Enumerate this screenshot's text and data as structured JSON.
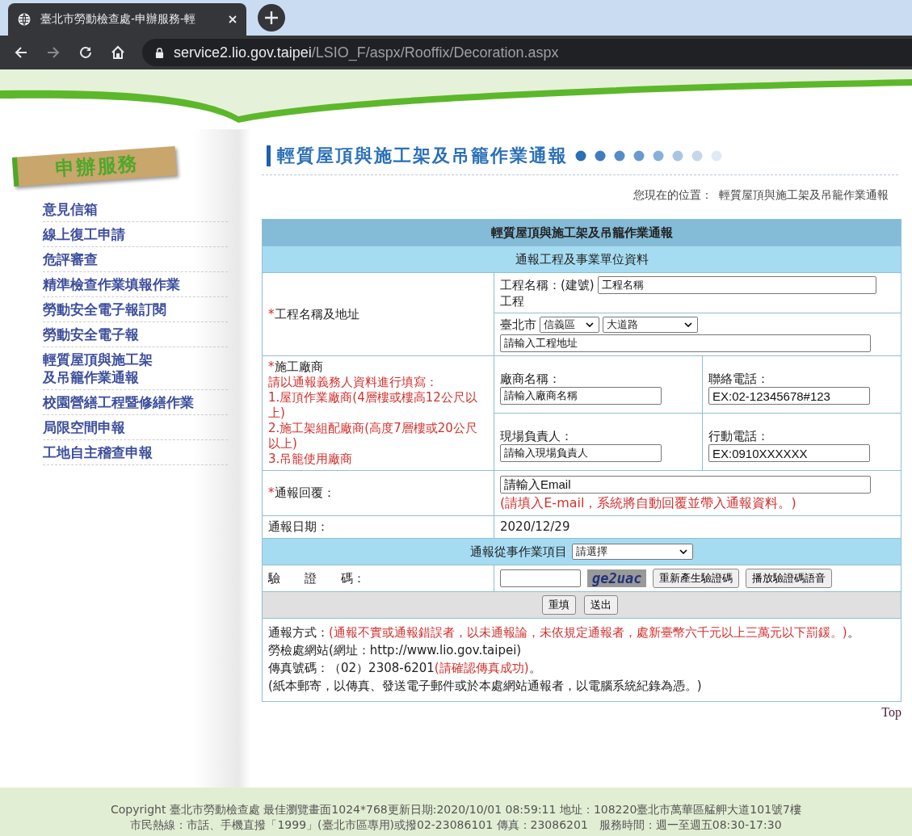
{
  "browser": {
    "tab_title": "臺北市勞動檢查處-申辦服務-輕",
    "url_host": "service2.lio.gov.taipei",
    "url_path": "/LSIO_F/aspx/Rooffix/Decoration.aspx"
  },
  "sidebar": {
    "banner": "申辦服務",
    "items": [
      {
        "lines": [
          "意見信箱"
        ]
      },
      {
        "lines": [
          "線上復工申請"
        ]
      },
      {
        "lines": [
          "危評審查"
        ]
      },
      {
        "lines": [
          "精準檢查作業填報作業"
        ]
      },
      {
        "lines": [
          "勞動安全電子報訂閱"
        ]
      },
      {
        "lines": [
          "勞動安全電子報"
        ]
      },
      {
        "lines": [
          "輕質屋頂與施工架",
          "及吊籠作業通報"
        ]
      },
      {
        "lines": [
          "校園營繕工程暨修繕作業"
        ]
      },
      {
        "lines": [
          "局限空間申報"
        ]
      },
      {
        "lines": [
          "工地自主稽查申報"
        ]
      }
    ]
  },
  "main": {
    "title": "輕質屋頂與施工架及吊籠作業通報",
    "breadcrumb_label": "您現在的位置：",
    "breadcrumb": "輕質屋頂與施工架及吊籠作業通報"
  },
  "form": {
    "title": "輕質屋頂與施工架及吊籠作業通報",
    "section": "通報工程及事業單位資料",
    "project": {
      "required_mark": "*",
      "label": "工程名稱及地址",
      "name_label": "工程名稱：(建號)",
      "name_value": "工程名稱",
      "name_suffix": "工程",
      "city": "臺北市",
      "district": "信義區",
      "road": "大道路",
      "address_value": "請輸入工程地址"
    },
    "contractor": {
      "required_mark": "*",
      "label": "施工廠商",
      "notes": [
        "請以通報義務人資料進行填寫：",
        "1.屋頂作業廠商(4層樓或樓高12公尺以上)",
        "2.施工架組配廠商(高度7層樓或20公尺以上)",
        "3.吊籠使用廠商"
      ],
      "fields": [
        {
          "label": "廠商名稱：",
          "value": "請輸入廠商名稱"
        },
        {
          "label": "聯絡電話：",
          "value": "EX:02-12345678#123"
        },
        {
          "label": "現場負責人：",
          "value": "請輸入現場負責人"
        },
        {
          "label": "行動電話：",
          "value": "EX:0910XXXXXX"
        }
      ]
    },
    "reply": {
      "required_mark": "*",
      "label": "通報回覆：",
      "value": "請輸入Email",
      "hint": "(請填入E-mail，系統將自動回覆並帶入通報資料。)"
    },
    "date": {
      "label": "通報日期：",
      "value": "2020/12/29"
    },
    "work_item": {
      "label": "通報從事作業項目",
      "value": "請選擇"
    },
    "captcha": {
      "label": "驗　　證　　碼：",
      "code": "ge2uac",
      "buttons": [
        "重新產生驗證碼",
        "播放驗證碼語音"
      ]
    },
    "actions": [
      "重填",
      "送出"
    ],
    "notes": [
      [
        {
          "kind": "normal",
          "text": "通報方式："
        },
        {
          "kind": "warning",
          "text": "(通報不實或通報錯誤者，以未通報論，未依規定通報者，處新臺幣六千元以上三萬元以下罰鍰。)"
        },
        {
          "kind": "normal",
          "text": "。"
        }
      ],
      [
        {
          "kind": "normal",
          "text": "勞檢處網站(網址：http://www.lio.gov.taipei)"
        }
      ],
      [
        {
          "kind": "normal",
          "text": "傳真號碼：（02）2308-6201"
        },
        {
          "kind": "warning",
          "text": "(請確認傳真成功)"
        },
        {
          "kind": "normal",
          "text": "。"
        }
      ],
      [
        {
          "kind": "normal",
          "text": "(紙本郵寄，以傳真、發送電子郵件或於本處網站通報者，以電腦系統紀錄為憑。)"
        }
      ]
    ]
  },
  "top_link": "Top",
  "footer": [
    "Copyright 臺北市勞動檢查處 最佳瀏覽畫面1024*768更新日期:2020/10/01 08:59:11 地址：108220臺北市萬華區艋舺大道101號7樓",
    "市民熱線：市話、手機直撥「1999」(臺北市區專用)或撥02-23086101 傳真：23086201　服務時間：週一至週五08:30-17:30"
  ]
}
